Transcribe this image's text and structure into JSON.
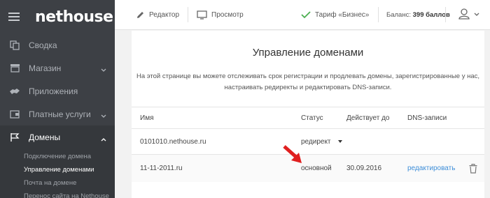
{
  "brand": {
    "logo_text": "nethouse"
  },
  "sidebar": {
    "items": [
      {
        "label": "Сводка",
        "icon": "copy-icon"
      },
      {
        "label": "Магазин",
        "icon": "store-icon"
      },
      {
        "label": "Приложения",
        "icon": "puzzle-icon"
      },
      {
        "label": "Платные услуги",
        "icon": "wallet-icon"
      },
      {
        "label": "Домены",
        "icon": "flag-icon"
      }
    ],
    "subitems": [
      {
        "label": "Подключение домена"
      },
      {
        "label": "Управление доменами"
      },
      {
        "label": "Почта на домене"
      },
      {
        "label": "Перенос сайта на Nethouse"
      }
    ]
  },
  "topbar": {
    "editor_label": "Редактор",
    "preview_label": "Просмотр",
    "tariff_label": "Тариф «Бизнес»",
    "balance_prefix": "Баланс:",
    "balance_value": "399 баллов"
  },
  "main": {
    "title": "Управление доменами",
    "description_line1": "На этой странице вы можете отслеживать срок регистрации и продлевать домены, зарегистрированные у нас,",
    "description_line2": "настраивать редиректы и редактировать DNS-записи."
  },
  "table": {
    "columns": [
      "Имя",
      "Статус",
      "Действует до",
      "DNS-записи"
    ],
    "rows": [
      {
        "name": "0101010.nethouse.ru",
        "status": "редирект",
        "valid_until": "",
        "dns": ""
      },
      {
        "name": "11-11-2011.ru",
        "status": "основной",
        "valid_until": "30.09.2016",
        "dns": "редактировать"
      }
    ]
  },
  "colors": {
    "sidebar_bg": "#3d4045",
    "accent_link": "#3e8ed8",
    "check_green": "#4caf50",
    "arrow_red": "#e02020"
  }
}
